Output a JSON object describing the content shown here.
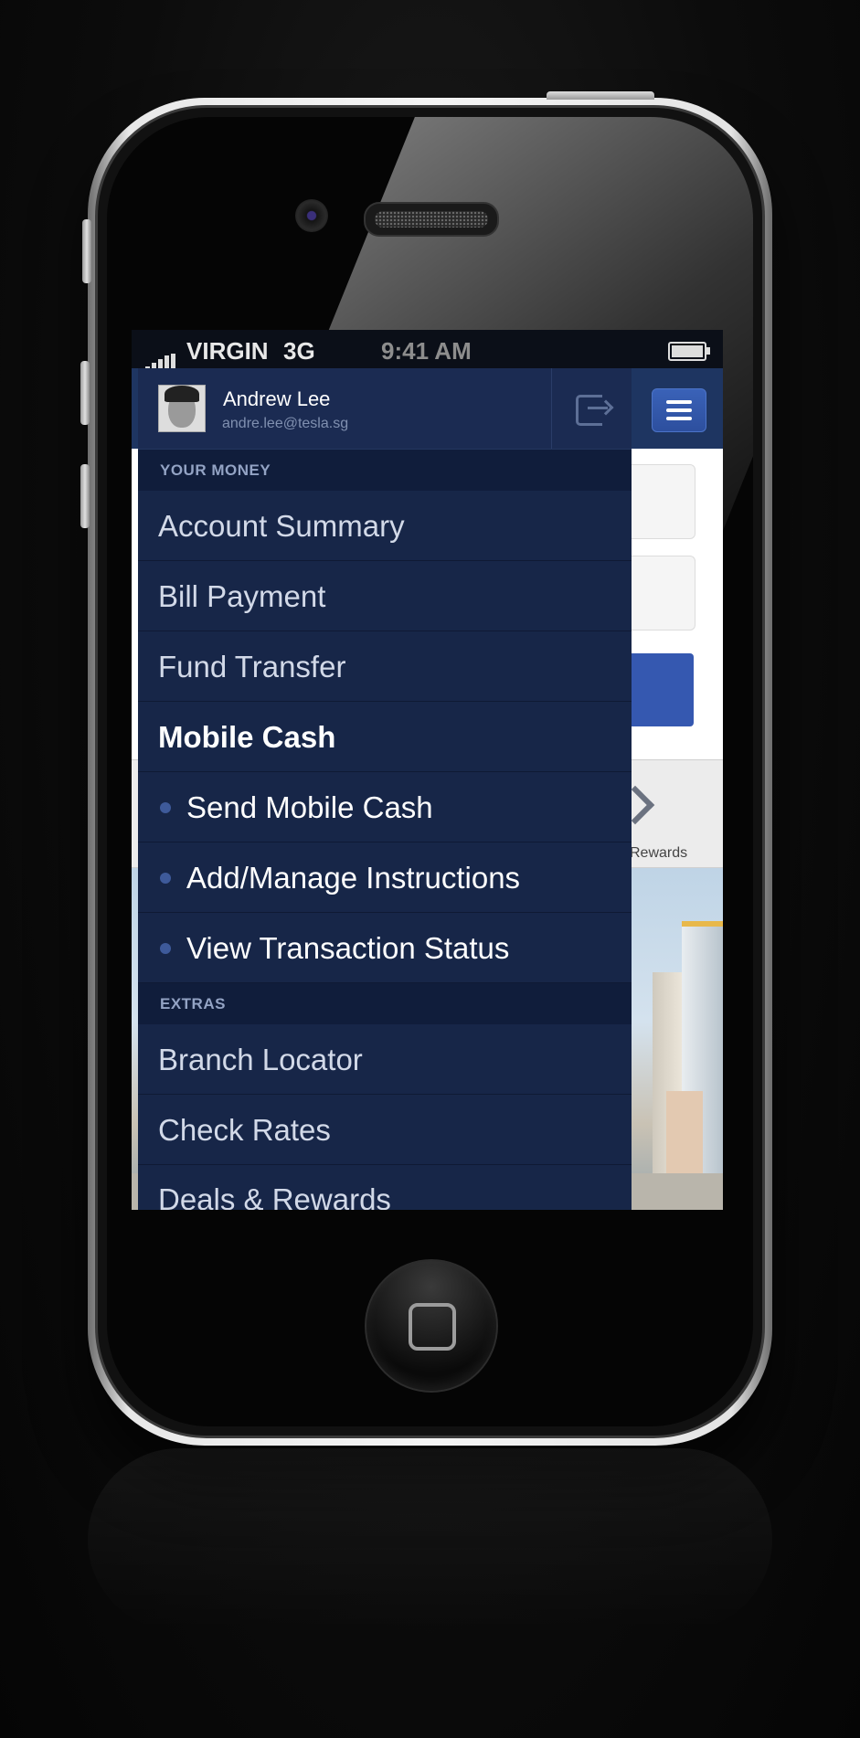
{
  "status_bar": {
    "carrier": "VIRGIN",
    "network": "3G",
    "time": "9:41 AM"
  },
  "user": {
    "name": "Andrew Lee",
    "email": "andre.lee@tesla.sg"
  },
  "menu": {
    "sections": [
      {
        "title": "YOUR MONEY",
        "items": [
          {
            "label": "Account Summary"
          },
          {
            "label": "Bill Payment"
          },
          {
            "label": "Fund Transfer"
          },
          {
            "label": "Mobile Cash",
            "active": true
          },
          {
            "label": "Send Mobile Cash",
            "sub": true
          },
          {
            "label": "Add/Manage Instructions",
            "sub": true
          },
          {
            "label": "View Transaction Status",
            "sub": true
          }
        ]
      },
      {
        "title": "EXTRAS",
        "items": [
          {
            "label": "Branch Locator"
          },
          {
            "label": "Check Rates"
          },
          {
            "label": "Deals & Rewards"
          }
        ]
      }
    ]
  },
  "background_app": {
    "tile_label": "Rewards"
  },
  "icons": [
    "signal-icon",
    "battery-icon",
    "logout-icon",
    "menu-icon",
    "rewards-icon"
  ],
  "colors": {
    "drawer": "#172648",
    "header": "#1b2b52",
    "section": "#101d3b",
    "accent": "#3558b0"
  }
}
